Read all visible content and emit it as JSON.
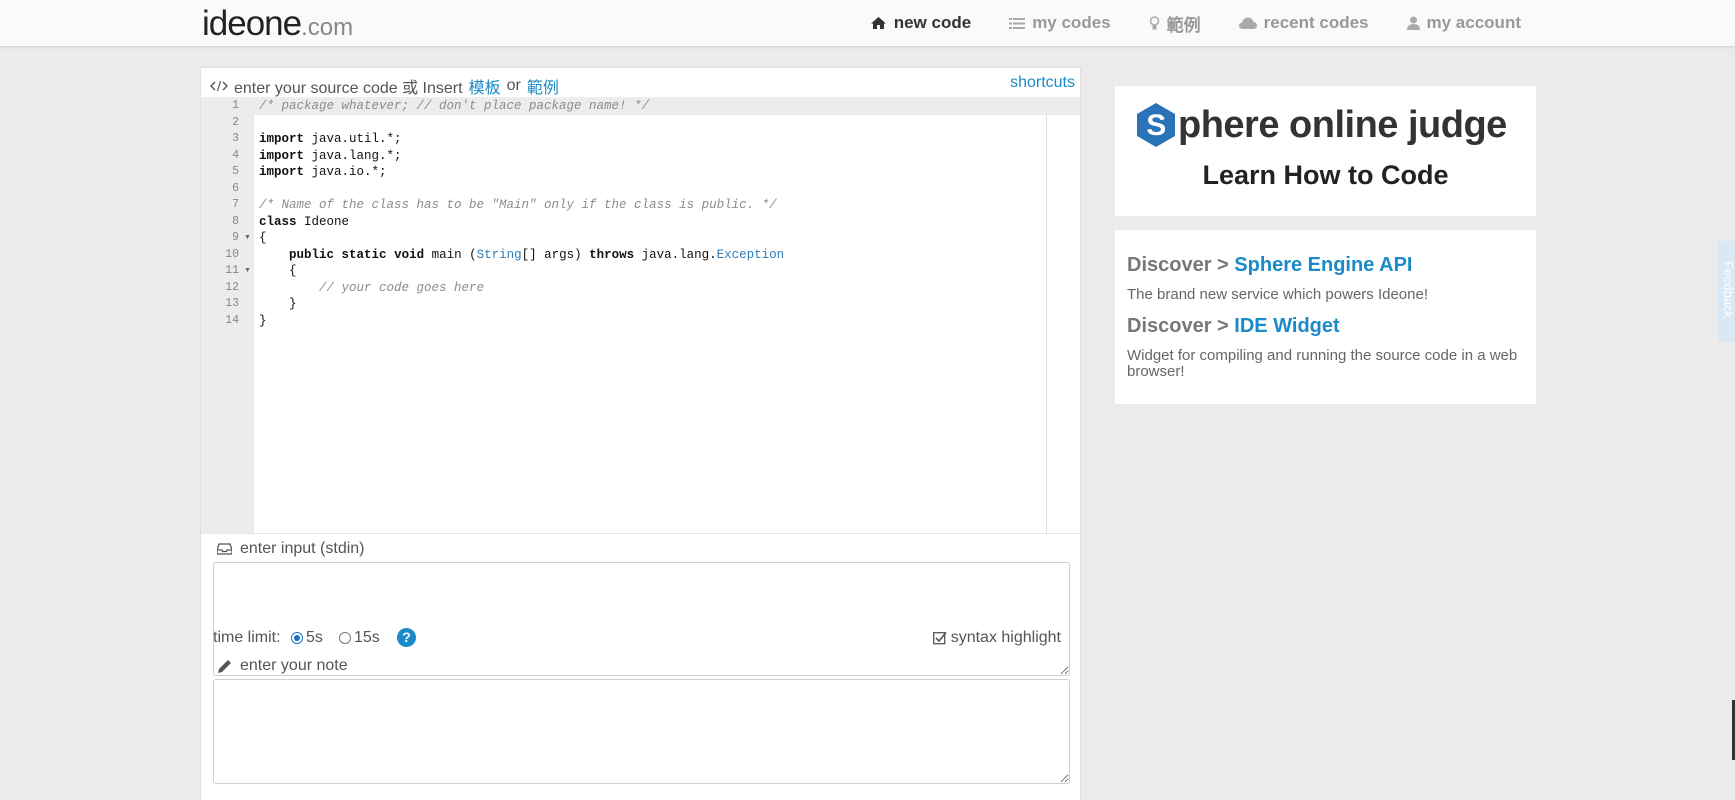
{
  "logo": {
    "main": "ideone",
    "suffix": ".com"
  },
  "nav": [
    {
      "label": "new code",
      "icon": "home-icon",
      "active": true
    },
    {
      "label": "my codes",
      "icon": "list-icon",
      "active": false
    },
    {
      "label": "範例",
      "icon": "lightbulb-icon",
      "active": false
    },
    {
      "label": "recent codes",
      "icon": "cloud-icon",
      "active": false
    },
    {
      "label": "my account",
      "icon": "user-icon",
      "active": false
    }
  ],
  "editor_header": {
    "prefix": "enter your source code 或 Insert",
    "template_link": "模板",
    "or": "or",
    "sample_link": "範例",
    "shortcuts": "shortcuts"
  },
  "code_lines": [
    "/* package whatever; // don't place package name! */",
    "",
    "import java.util.*;",
    "import java.lang.*;",
    "import java.io.*;",
    "",
    "/* Name of the class has to be \"Main\" only if the class is public. */",
    "class Ideone",
    "{",
    "    public static void main (String[] args) throws java.lang.Exception",
    "    {",
    "        // your code goes here",
    "    }",
    "}"
  ],
  "line_numbers": [
    "1",
    "2",
    "3",
    "4",
    "5",
    "6",
    "7",
    "8",
    "9",
    "10",
    "11",
    "12",
    "13",
    "14"
  ],
  "stdin": {
    "label": "enter input (stdin)",
    "value": ""
  },
  "options": {
    "time_limit_label": "time limit:",
    "opt_5s": "5s",
    "opt_15s": "15s",
    "selected": "5s",
    "help": "?",
    "syntax_highlight": "syntax highlight",
    "syntax_checked": true
  },
  "note": {
    "label": "enter your note",
    "value": ""
  },
  "ad": {
    "brand_letter": "S",
    "brand_rest": "phere online judge",
    "tagline": "Learn How to Code",
    "brand_color": "#2b73b8"
  },
  "discover": [
    {
      "prefix": "Discover > ",
      "link": "Sphere Engine API",
      "desc": "The brand new service which powers Ideone!"
    },
    {
      "prefix": "Discover > ",
      "link": "IDE Widget",
      "desc": "Widget for compiling and running the source code in a web browser!"
    }
  ],
  "feedback": "Feedback",
  "colors": {
    "accent": "#1a8ac9",
    "background": "#ebebeb"
  }
}
